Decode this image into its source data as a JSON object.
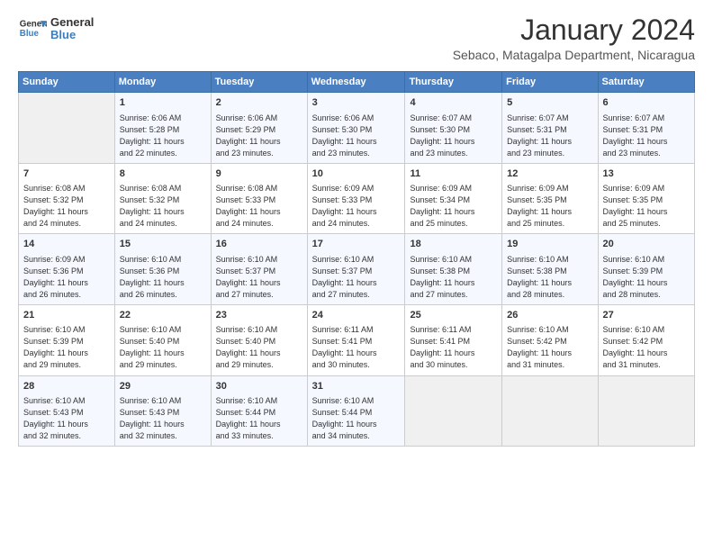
{
  "app": {
    "logo_general": "General",
    "logo_blue": "Blue"
  },
  "title": "January 2024",
  "location": "Sebaco, Matagalpa Department, Nicaragua",
  "days_of_week": [
    "Sunday",
    "Monday",
    "Tuesday",
    "Wednesday",
    "Thursday",
    "Friday",
    "Saturday"
  ],
  "weeks": [
    [
      {
        "day": "",
        "sunrise": "",
        "sunset": "",
        "daylight": "",
        "empty": true
      },
      {
        "day": "1",
        "sunrise": "Sunrise: 6:06 AM",
        "sunset": "Sunset: 5:28 PM",
        "daylight": "Daylight: 11 hours and 22 minutes."
      },
      {
        "day": "2",
        "sunrise": "Sunrise: 6:06 AM",
        "sunset": "Sunset: 5:29 PM",
        "daylight": "Daylight: 11 hours and 23 minutes."
      },
      {
        "day": "3",
        "sunrise": "Sunrise: 6:06 AM",
        "sunset": "Sunset: 5:30 PM",
        "daylight": "Daylight: 11 hours and 23 minutes."
      },
      {
        "day": "4",
        "sunrise": "Sunrise: 6:07 AM",
        "sunset": "Sunset: 5:30 PM",
        "daylight": "Daylight: 11 hours and 23 minutes."
      },
      {
        "day": "5",
        "sunrise": "Sunrise: 6:07 AM",
        "sunset": "Sunset: 5:31 PM",
        "daylight": "Daylight: 11 hours and 23 minutes."
      },
      {
        "day": "6",
        "sunrise": "Sunrise: 6:07 AM",
        "sunset": "Sunset: 5:31 PM",
        "daylight": "Daylight: 11 hours and 23 minutes."
      }
    ],
    [
      {
        "day": "7",
        "sunrise": "Sunrise: 6:08 AM",
        "sunset": "Sunset: 5:32 PM",
        "daylight": "Daylight: 11 hours and 24 minutes."
      },
      {
        "day": "8",
        "sunrise": "Sunrise: 6:08 AM",
        "sunset": "Sunset: 5:32 PM",
        "daylight": "Daylight: 11 hours and 24 minutes."
      },
      {
        "day": "9",
        "sunrise": "Sunrise: 6:08 AM",
        "sunset": "Sunset: 5:33 PM",
        "daylight": "Daylight: 11 hours and 24 minutes."
      },
      {
        "day": "10",
        "sunrise": "Sunrise: 6:09 AM",
        "sunset": "Sunset: 5:33 PM",
        "daylight": "Daylight: 11 hours and 24 minutes."
      },
      {
        "day": "11",
        "sunrise": "Sunrise: 6:09 AM",
        "sunset": "Sunset: 5:34 PM",
        "daylight": "Daylight: 11 hours and 25 minutes."
      },
      {
        "day": "12",
        "sunrise": "Sunrise: 6:09 AM",
        "sunset": "Sunset: 5:35 PM",
        "daylight": "Daylight: 11 hours and 25 minutes."
      },
      {
        "day": "13",
        "sunrise": "Sunrise: 6:09 AM",
        "sunset": "Sunset: 5:35 PM",
        "daylight": "Daylight: 11 hours and 25 minutes."
      }
    ],
    [
      {
        "day": "14",
        "sunrise": "Sunrise: 6:09 AM",
        "sunset": "Sunset: 5:36 PM",
        "daylight": "Daylight: 11 hours and 26 minutes."
      },
      {
        "day": "15",
        "sunrise": "Sunrise: 6:10 AM",
        "sunset": "Sunset: 5:36 PM",
        "daylight": "Daylight: 11 hours and 26 minutes."
      },
      {
        "day": "16",
        "sunrise": "Sunrise: 6:10 AM",
        "sunset": "Sunset: 5:37 PM",
        "daylight": "Daylight: 11 hours and 27 minutes."
      },
      {
        "day": "17",
        "sunrise": "Sunrise: 6:10 AM",
        "sunset": "Sunset: 5:37 PM",
        "daylight": "Daylight: 11 hours and 27 minutes."
      },
      {
        "day": "18",
        "sunrise": "Sunrise: 6:10 AM",
        "sunset": "Sunset: 5:38 PM",
        "daylight": "Daylight: 11 hours and 27 minutes."
      },
      {
        "day": "19",
        "sunrise": "Sunrise: 6:10 AM",
        "sunset": "Sunset: 5:38 PM",
        "daylight": "Daylight: 11 hours and 28 minutes."
      },
      {
        "day": "20",
        "sunrise": "Sunrise: 6:10 AM",
        "sunset": "Sunset: 5:39 PM",
        "daylight": "Daylight: 11 hours and 28 minutes."
      }
    ],
    [
      {
        "day": "21",
        "sunrise": "Sunrise: 6:10 AM",
        "sunset": "Sunset: 5:39 PM",
        "daylight": "Daylight: 11 hours and 29 minutes."
      },
      {
        "day": "22",
        "sunrise": "Sunrise: 6:10 AM",
        "sunset": "Sunset: 5:40 PM",
        "daylight": "Daylight: 11 hours and 29 minutes."
      },
      {
        "day": "23",
        "sunrise": "Sunrise: 6:10 AM",
        "sunset": "Sunset: 5:40 PM",
        "daylight": "Daylight: 11 hours and 29 minutes."
      },
      {
        "day": "24",
        "sunrise": "Sunrise: 6:11 AM",
        "sunset": "Sunset: 5:41 PM",
        "daylight": "Daylight: 11 hours and 30 minutes."
      },
      {
        "day": "25",
        "sunrise": "Sunrise: 6:11 AM",
        "sunset": "Sunset: 5:41 PM",
        "daylight": "Daylight: 11 hours and 30 minutes."
      },
      {
        "day": "26",
        "sunrise": "Sunrise: 6:10 AM",
        "sunset": "Sunset: 5:42 PM",
        "daylight": "Daylight: 11 hours and 31 minutes."
      },
      {
        "day": "27",
        "sunrise": "Sunrise: 6:10 AM",
        "sunset": "Sunset: 5:42 PM",
        "daylight": "Daylight: 11 hours and 31 minutes."
      }
    ],
    [
      {
        "day": "28",
        "sunrise": "Sunrise: 6:10 AM",
        "sunset": "Sunset: 5:43 PM",
        "daylight": "Daylight: 11 hours and 32 minutes."
      },
      {
        "day": "29",
        "sunrise": "Sunrise: 6:10 AM",
        "sunset": "Sunset: 5:43 PM",
        "daylight": "Daylight: 11 hours and 32 minutes."
      },
      {
        "day": "30",
        "sunrise": "Sunrise: 6:10 AM",
        "sunset": "Sunset: 5:44 PM",
        "daylight": "Daylight: 11 hours and 33 minutes."
      },
      {
        "day": "31",
        "sunrise": "Sunrise: 6:10 AM",
        "sunset": "Sunset: 5:44 PM",
        "daylight": "Daylight: 11 hours and 34 minutes."
      },
      {
        "day": "",
        "sunrise": "",
        "sunset": "",
        "daylight": "",
        "empty": true
      },
      {
        "day": "",
        "sunrise": "",
        "sunset": "",
        "daylight": "",
        "empty": true
      },
      {
        "day": "",
        "sunrise": "",
        "sunset": "",
        "daylight": "",
        "empty": true
      }
    ]
  ]
}
